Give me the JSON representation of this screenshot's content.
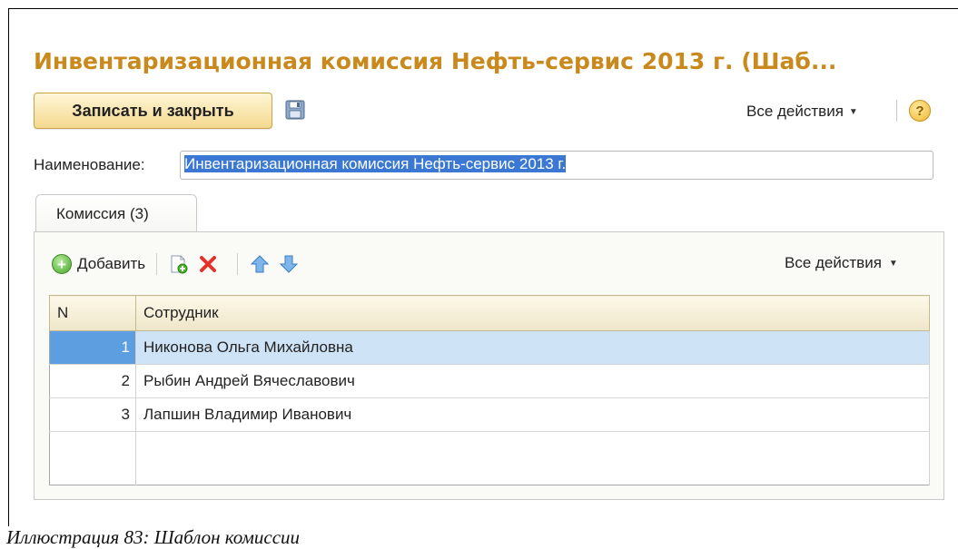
{
  "window": {
    "title": "Инвентаризационная комиссия Нефть-сервис 2013 г. (Шаб..."
  },
  "toolbar": {
    "save_close_label": "Записать и закрыть",
    "all_actions_label": "Все действия",
    "help_label": "?"
  },
  "form": {
    "name_label": "Наименование:",
    "name_value": "Инвентаризационная комиссия Нефть-сервис 2013 г."
  },
  "tabs": [
    {
      "label": "Комиссия (3)"
    }
  ],
  "table_toolbar": {
    "add_label": "Добавить",
    "all_actions_label": "Все действия"
  },
  "table": {
    "columns": [
      "N",
      "Сотрудник"
    ],
    "rows": [
      {
        "n": "1",
        "employee": "Никонова Ольга Михайловна"
      },
      {
        "n": "2",
        "employee": "Рыбин Андрей Вячеславович"
      },
      {
        "n": "3",
        "employee": "Лапшин Владимир Иванович"
      }
    ],
    "selected_row": 1
  },
  "caption": "Иллюстрация 83: Шаблон комиссии",
  "colors": {
    "title": "#c9891c",
    "selection": "#3a78d4",
    "row_selected": "#cfe3f6"
  },
  "icons": [
    "floppy-disk-icon",
    "help-icon",
    "add-icon",
    "copy-icon",
    "delete-icon",
    "move-up-icon",
    "move-down-icon",
    "dropdown-caret-icon"
  ]
}
